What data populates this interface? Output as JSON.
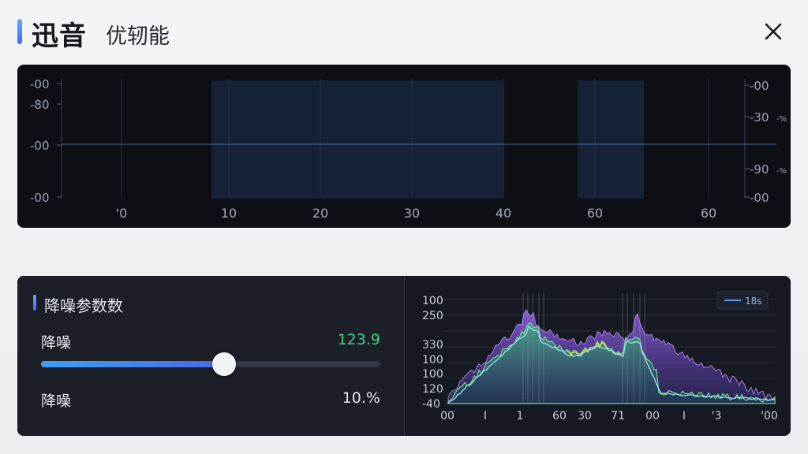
{
  "header": {
    "title": "迅音",
    "subtitle": "优轫能"
  },
  "waveform": {
    "left_axis_labels": [
      "-00",
      "-80",
      "-00",
      "-00"
    ],
    "right_axis_labels": [
      "-00",
      "-30",
      "-00",
      "-90",
      "-00"
    ],
    "right_axis_units": [
      "",
      "-%",
      "",
      "-%",
      ""
    ],
    "time_ticks": [
      "'0",
      "10",
      "20",
      "30",
      "40",
      "60",
      "60"
    ],
    "colors": {
      "wave_start": "#4c6fd8",
      "wave_end": "#5cc8ea",
      "selection": "#1e3250",
      "background": "#0d0f15"
    }
  },
  "params": {
    "title": "降噪参数数",
    "rows": [
      {
        "label": "降噪",
        "value": "123.9",
        "value_color": "#41d17d"
      },
      {
        "label": "降噪",
        "value": "10.%",
        "value_color": "#e4e6ec"
      }
    ],
    "slider_level": 0.54
  },
  "spectrum": {
    "y_labels": [
      "100",
      "250",
      "330",
      "100",
      "100",
      "120",
      "-40"
    ],
    "x_labels": [
      "00",
      "I",
      "1",
      "60",
      "30",
      "71",
      "00",
      "I",
      "'3",
      "'00"
    ],
    "legend_label": "18s",
    "colors": {
      "purple": "#7a4fc9",
      "green": "#4fc38a",
      "yellow": "#d8d447",
      "cyan": "#8fe0e8"
    }
  }
}
